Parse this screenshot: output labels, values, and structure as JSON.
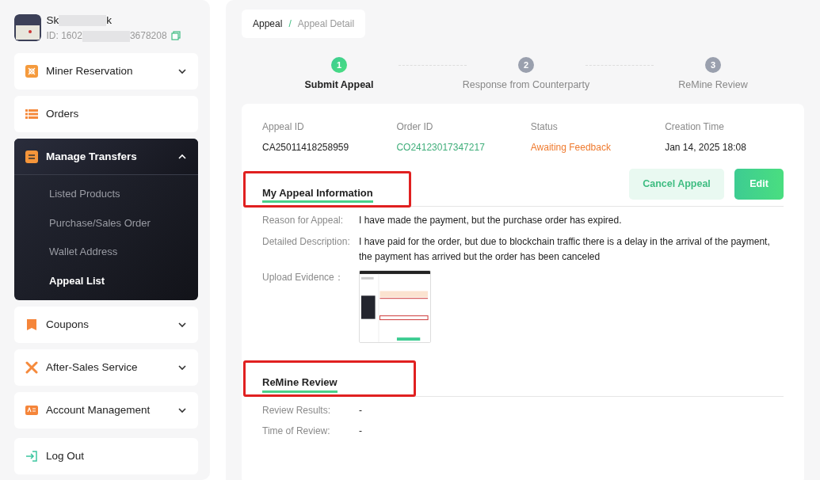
{
  "user": {
    "name_start": "Sk",
    "name_end": "k",
    "id_start": "ID: 1602",
    "id_end": "3678208"
  },
  "sidebar": {
    "items": [
      {
        "label": "Miner Reservation",
        "expanded": false,
        "has_caret": true
      },
      {
        "label": "Orders",
        "expanded": false,
        "has_caret": false
      },
      {
        "label": "Manage Transfers",
        "expanded": true,
        "has_caret": true,
        "children": [
          {
            "label": "Listed Products",
            "selected": false
          },
          {
            "label": "Purchase/Sales Order",
            "selected": false
          },
          {
            "label": "Wallet Address",
            "selected": false
          },
          {
            "label": "Appeal List",
            "selected": true
          }
        ]
      },
      {
        "label": "Coupons",
        "expanded": false,
        "has_caret": true
      },
      {
        "label": "After-Sales Service",
        "expanded": false,
        "has_caret": true
      },
      {
        "label": "Account Management",
        "expanded": false,
        "has_caret": true
      }
    ],
    "logout": "Log Out"
  },
  "breadcrumb": [
    "Appeal",
    "Appeal Detail"
  ],
  "breadcrumb_separator": "/",
  "steps": [
    {
      "number": "1",
      "label": "Submit Appeal",
      "active": true
    },
    {
      "number": "2",
      "label": "Response from Counterparty",
      "active": false
    },
    {
      "number": "3",
      "label": "ReMine Review",
      "active": false
    }
  ],
  "summary": [
    {
      "label": "Appeal ID",
      "value": "CA25011418258959",
      "kind": "plain"
    },
    {
      "label": "Order ID",
      "value": "CO24123017347217",
      "kind": "link"
    },
    {
      "label": "Status",
      "value": "Awaiting Feedback",
      "kind": "status"
    },
    {
      "label": "Creation Time",
      "value": "Jan 14, 2025 18:08",
      "kind": "plain"
    }
  ],
  "buttons": [
    {
      "label": "Cancel Appeal",
      "kind": "secondary"
    },
    {
      "label": "Edit",
      "kind": "primary"
    }
  ],
  "sections": [
    {
      "title": "My Appeal Information",
      "highlighted": true,
      "fields": [
        {
          "label": "Reason for Appeal:",
          "value": "I have made the payment, but the purchase order has expired.",
          "kind": "text"
        },
        {
          "label": "Detailed Description:",
          "value": "I have paid for the order, but due to blockchain traffic there is a delay in the arrival of the payment, the payment has arrived but the order has been canceled",
          "kind": "text"
        },
        {
          "label": "Upload Evidence：",
          "kind": "image"
        }
      ]
    },
    {
      "title": "ReMine Review",
      "highlighted": true,
      "fields": [
        {
          "label": "Review Results:",
          "value": "-",
          "kind": "text"
        },
        {
          "label": "Time of Review:",
          "value": "-",
          "kind": "text"
        }
      ]
    }
  ]
}
